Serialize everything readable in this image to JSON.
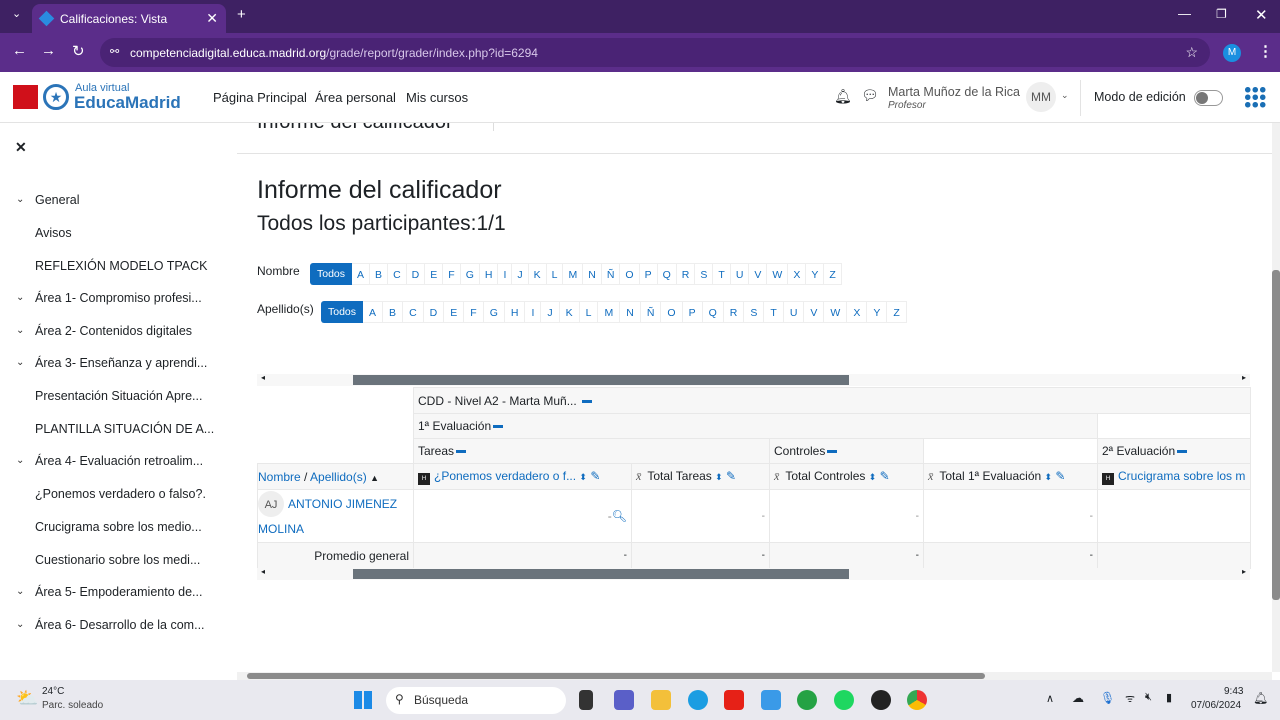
{
  "browser": {
    "tab_title": "Calificaciones: Vista",
    "url_domain": "competenciadigital.educa.madrid.org",
    "url_path": "/grade/report/grader/index.php?id=6294",
    "profile": "M"
  },
  "header": {
    "logo_top": "Aula virtual",
    "logo_bottom": "EducaMadrid",
    "nav": [
      "Página Principal",
      "Área personal",
      "Mis cursos"
    ],
    "user_name": "Marta Muñoz de la Rica",
    "user_role": "Profesor",
    "avatar": "MM",
    "edit_mode": "Modo de edición",
    "edit_mode_on": false
  },
  "drawer": {
    "items": [
      {
        "label": "General",
        "chevron": true
      },
      {
        "label": "Avisos",
        "chevron": false
      },
      {
        "label": "REFLEXIÓN MODELO TPACK",
        "chevron": false
      },
      {
        "label": "Área 1- Compromiso profesi...",
        "chevron": true
      },
      {
        "label": "Área 2- Contenidos digitales",
        "chevron": true
      },
      {
        "label": "Área 3- Enseñanza y aprendi...",
        "chevron": true
      },
      {
        "label": "Presentación Situación Apre...",
        "chevron": false
      },
      {
        "label": "PLANTILLA SITUACIÓN DE A...",
        "chevron": false
      },
      {
        "label": "Área 4- Evaluación retroalim...",
        "chevron": true
      },
      {
        "label": "¿Ponemos verdadero o falso?.",
        "chevron": false
      },
      {
        "label": "Crucigrama sobre los medio...",
        "chevron": false
      },
      {
        "label": "Cuestionario sobre los medi...",
        "chevron": false
      },
      {
        "label": "Área 5- Empoderamiento de...",
        "chevron": true
      },
      {
        "label": "Área 6- Desarrollo de la com...",
        "chevron": true
      }
    ]
  },
  "main": {
    "cut_title": "Informe del calificador",
    "title": "Informe del calificador",
    "subtitle": "Todos los participantes:1/1",
    "first_label": "Nombre",
    "last_label": "Apellido(s)",
    "all": "Todos",
    "letters": [
      "A",
      "B",
      "C",
      "D",
      "E",
      "F",
      "G",
      "H",
      "I",
      "J",
      "K",
      "L",
      "M",
      "N",
      "Ñ",
      "O",
      "P",
      "Q",
      "R",
      "S",
      "T",
      "U",
      "V",
      "W",
      "X",
      "Y",
      "Z"
    ]
  },
  "grader": {
    "course": "CDD - Nivel A2 - Marta Muñ...",
    "eval1": "1ª Evaluación",
    "tareas": "Tareas",
    "controles": "Controles",
    "eval2": "2ª Evaluación",
    "name_header": "Nombre",
    "surname_header": "Apellido(s)",
    "columns": [
      "¿Ponemos verdadero o f...",
      "Total Tareas",
      "Total Controles",
      "Total 1ª Evaluación",
      "Crucigrama sobre los m"
    ],
    "student": {
      "initials": "AJ",
      "name": "ANTONIO JIMENEZ MOLINA",
      "grades": [
        "-",
        "-",
        "-",
        "-",
        ""
      ]
    },
    "average_label": "Promedio general",
    "averages": [
      "-",
      "-",
      "-",
      "-",
      ""
    ]
  },
  "taskbar": {
    "temp": "24°C",
    "weather": "Parc. soleado",
    "search": "Búsqueda",
    "time": "9:43",
    "date": "07/06/2024"
  }
}
